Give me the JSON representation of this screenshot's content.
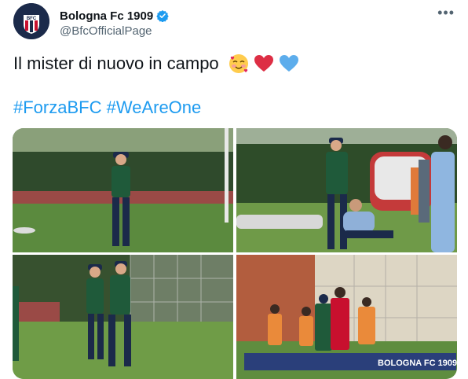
{
  "account": {
    "display_name": "Bologna Fc 1909",
    "handle": "@BfcOfficialPage",
    "avatar_text": "BFC",
    "verified": true
  },
  "menu_icon": "more-horizontal-icon",
  "tweet": {
    "text": "Il mister di nuovo in campo",
    "emojis": [
      "smiling-face-with-hearts",
      "red-heart",
      "blue-heart"
    ],
    "hashtags": [
      "#ForzaBFC",
      "#WeAreOne"
    ]
  },
  "media": {
    "photo_count": 4,
    "photo4_banner": "BOLOGNA FC 1909"
  },
  "colors": {
    "link": "#1d9bf0",
    "secondary_text": "#536471",
    "brand_navy": "#1b2a4a",
    "brand_red": "#c8102e"
  }
}
